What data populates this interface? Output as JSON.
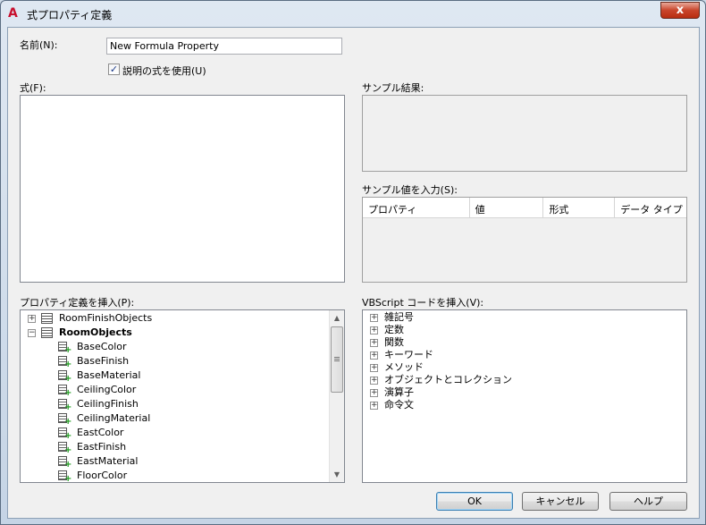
{
  "window": {
    "title": "式プロパティ定義",
    "app_icon_glyph": "A",
    "close_glyph": "x"
  },
  "name_field": {
    "label": "名前(N):",
    "value": "New Formula Property"
  },
  "use_formula_description": {
    "checked": true,
    "check_glyph": "✓",
    "label": "説明の式を使用(U)"
  },
  "formula": {
    "label": "式(F):"
  },
  "sample_result": {
    "label": "サンプル結果:"
  },
  "sample_values": {
    "label": "サンプル値を入力(S):",
    "columns": [
      "プロパティ",
      "値",
      "形式",
      "データ タイプ"
    ]
  },
  "insert_property": {
    "label": "プロパティ定義を挿入(P):",
    "tree": [
      {
        "label": "RoomFinishObjects",
        "expander": "+",
        "bold": false
      },
      {
        "label": "RoomObjects",
        "expander": "−",
        "bold": true
      },
      {
        "label": "BaseColor"
      },
      {
        "label": "BaseFinish"
      },
      {
        "label": "BaseMaterial"
      },
      {
        "label": "CeilingColor"
      },
      {
        "label": "CeilingFinish"
      },
      {
        "label": "CeilingMaterial"
      },
      {
        "label": "EastColor"
      },
      {
        "label": "EastFinish"
      },
      {
        "label": "EastMaterial"
      },
      {
        "label": "FloorColor"
      }
    ]
  },
  "insert_vbscript": {
    "label": "VBScript コードを挿入(V):",
    "items": [
      "雑記号",
      "定数",
      "関数",
      "キーワード",
      "メソッド",
      "オブジェクトとコレクション",
      "演算子",
      "命令文"
    ]
  },
  "buttons": {
    "ok": "OK",
    "cancel": "キャンセル",
    "help": "ヘルプ"
  },
  "scroll": {
    "up": "▲",
    "down": "▼"
  }
}
